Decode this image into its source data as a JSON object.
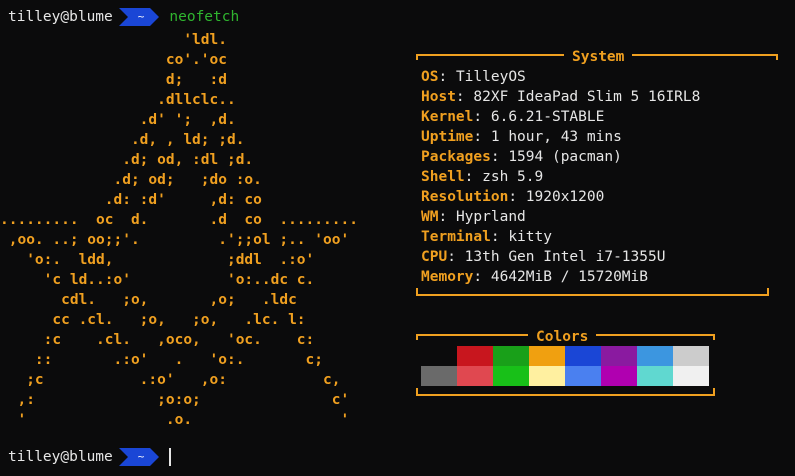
{
  "prompt": {
    "user": "tilley@blume",
    "dir": "~",
    "command": "neofetch"
  },
  "logo_lines": [
    "                     'ldl.",
    "                   co'.'oc",
    "                   d;   :d",
    "                  .dllclc..",
    "                .d' ';  ,d.",
    "               .d, , ld; ;d.",
    "              .d; od, :dl ;d.",
    "             .d; od;   ;do :o.",
    "            .d: :d'     ,d: co",
    ".........  oc  d.       .d  co  .........",
    " ,oo. ..; oo;;'.         .';;ol ;.. 'oo'",
    "   'o:.  ldd,             ;ddl  .:o'",
    "     'c ld..:o'           'o:..dc c.",
    "       cdl.   ;o,       ,o;   .ldc",
    "      cc .cl.   ;o,   ;o,   .lc. l:",
    "     :c    .cl.   ,oco,   'oc.    c:",
    "    ::       .:o'   .   'o:.       c;",
    "   ;c           .:o'   ,o:           c,",
    "  ,:              ;o:o;               c'",
    "  '                .o.                 '"
  ],
  "system": {
    "title": "System",
    "rows": [
      {
        "key": "OS",
        "value": "TilleyOS"
      },
      {
        "key": "Host",
        "value": "82XF IdeaPad Slim 5 16IRL8"
      },
      {
        "key": "Kernel",
        "value": "6.6.21-STABLE"
      },
      {
        "key": "Uptime",
        "value": "1 hour, 43 mins"
      },
      {
        "key": "Packages",
        "value": "1594 (pacman)"
      },
      {
        "key": "Shell",
        "value": "zsh 5.9"
      },
      {
        "key": "Resolution",
        "value": "1920x1200"
      },
      {
        "key": "WM",
        "value": "Hyprland"
      },
      {
        "key": "Terminal",
        "value": "kitty"
      },
      {
        "key": "CPU",
        "value": "13th Gen Intel i7-1355U"
      },
      {
        "key": "Memory",
        "value": "4642MiB / 15720MiB"
      }
    ]
  },
  "colors": {
    "title": "Colors",
    "normal": [
      "#0b0b0c",
      "#c8161e",
      "#19a019",
      "#f0a010",
      "#1a46d6",
      "#8a1aa0",
      "#3c96e0",
      "#cccccc"
    ],
    "bright": [
      "#6a6a6a",
      "#e04850",
      "#18c018",
      "#fff0a0",
      "#4a80f0",
      "#b000b0",
      "#60d8d0",
      "#f0f0f0"
    ]
  },
  "accent": "#f0a020"
}
